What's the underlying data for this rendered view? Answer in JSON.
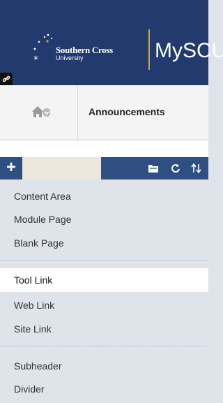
{
  "header": {
    "logo_name": "Southern Cross",
    "logo_sub": "University",
    "app_name": "MySCU",
    "link_icon": "link-icon"
  },
  "breadcrumb": {
    "home_icon": "home-icon",
    "dropdown_icon": "chevron-down-circle-icon",
    "title": "Announcements"
  },
  "toolbar": {
    "add_label": "+",
    "icons": [
      "folder-icon",
      "refresh-icon",
      "sort-icon"
    ]
  },
  "menu": {
    "items": [
      {
        "label": "Content Area"
      },
      {
        "label": "Module Page"
      },
      {
        "label": "Blank Page"
      },
      {
        "label": "Tool Link"
      },
      {
        "label": "Web Link"
      },
      {
        "label": "Site Link"
      },
      {
        "label": "Subheader"
      },
      {
        "label": "Divider"
      }
    ]
  },
  "colors": {
    "header_bg": "#223a6e",
    "toolbar_bg": "#2f4e82",
    "menu_bg": "#dfe3ea",
    "accent": "#e3a21a"
  }
}
